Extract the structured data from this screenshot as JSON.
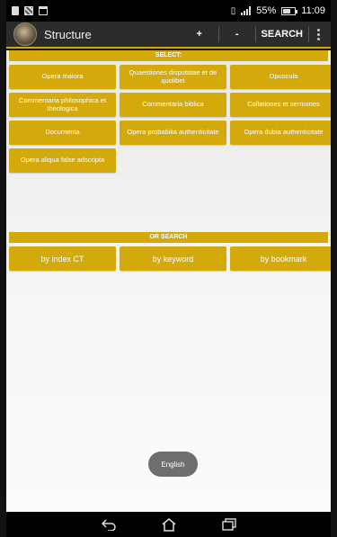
{
  "status_bar": {
    "battery_text": "55%",
    "time": "11:09"
  },
  "action_bar": {
    "title": "Structure",
    "plus_label": "+",
    "minus_label": "-",
    "search_label": "SEARCH"
  },
  "select_section": {
    "header": "SELECT:",
    "items": [
      {
        "label": "Opera maiora"
      },
      {
        "label": "Quaestiones disputatae et de quolibet"
      },
      {
        "label": "Opuscula"
      },
      {
        "label": "Commentaria philosophica et theologica"
      },
      {
        "label": "Commentaria biblica"
      },
      {
        "label": "Collationes et sermones"
      },
      {
        "label": "Documenta"
      },
      {
        "label": "Opera probabilia authenticitate"
      },
      {
        "label": "Opera dubia authenticitate"
      },
      {
        "label": "Opera aliqua false adscripta"
      }
    ]
  },
  "search_section": {
    "header": "OR SEARCH",
    "items": [
      {
        "label": "by index CT"
      },
      {
        "label": "by keyword"
      },
      {
        "label": "by bookmark"
      }
    ]
  },
  "toast": {
    "text": "English"
  },
  "colors": {
    "accent": "#d4a90c",
    "action_bar": "#2c2c2c"
  }
}
